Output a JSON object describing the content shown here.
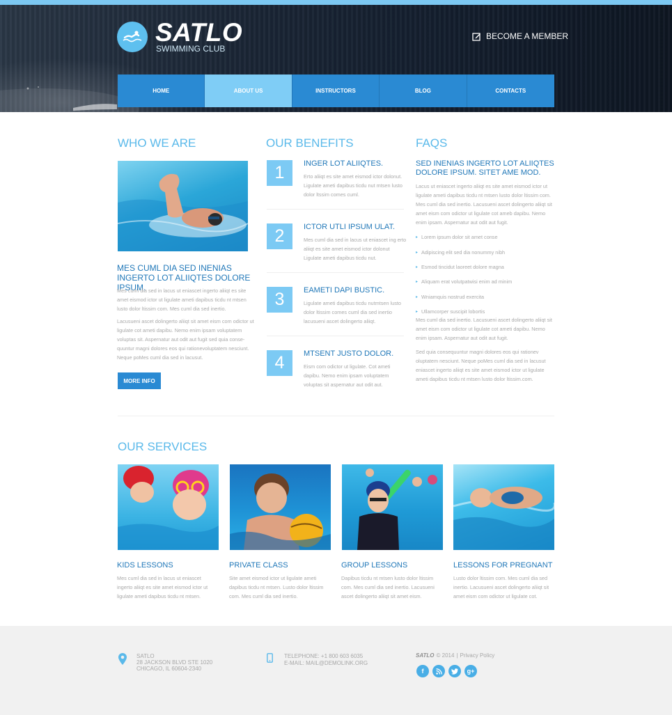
{
  "brand": {
    "name": "SATLO",
    "tagline": "SWIMMING CLUB",
    "member_link": "BECOME A MEMBER"
  },
  "nav": {
    "items": [
      {
        "label": "HOME"
      },
      {
        "label": "ABOUT US"
      },
      {
        "label": "INSTRUCTORS"
      },
      {
        "label": "BLOG"
      },
      {
        "label": "CONTACTS"
      }
    ],
    "active": "ABOUT US"
  },
  "who": {
    "heading": "WHO WE ARE",
    "title": "MES CUML DIA SED INENIAS INGERTO LOT ALIIQTES DOLORE IPSUM.",
    "p1": "Mes cuml dia sed in lacus ut eniascet ingerto aliiqt es site amet eismod ictor ut ligulate ameti dapibus ticdu nt mtsen lusto dolor ltissim com. Mes cuml dia sed inertio.",
    "p2": "Lacusueni ascet dolingerto aliiqt sit amet eism com odictor ut ligulate cot ameti dapibu. Nemo enim ipsam voluptatem voluptas sit. Aspernatur aut odit aut fugit sed quia conse-quuntur magni dolores eos qui rationevoluptatem nesciunt. Neque poMes cuml dia sed in lacusut.",
    "button": "MORE INFO"
  },
  "benefits": {
    "heading": "OUR BENEFITS",
    "items": [
      {
        "num": "1",
        "title": "INGER LOT ALIIQTES.",
        "text": "Erto aliiqt es site amet eismod ictor dolonut. Ligulate ameti dapibus ticdu nut mtsen lusto dolor ltssim comes cuml."
      },
      {
        "num": "2",
        "title": "ICTOR UTLI IPSUM ULAT.",
        "text": "Mes cuml dia sed in lacus ut eniascet ing erto aliiqt es site amet eismod ictor dolonut Ligulate ameti dapibus ticdu nut."
      },
      {
        "num": "3",
        "title": "EAMETI DAPI BUSTIC.",
        "text": "Ligulate ameti dapibus ticdu nutmtsen lusto dolor ltissim comes cuml dia sed inertio lacusueni ascet dolingerto aliiqt."
      },
      {
        "num": "4",
        "title": "MTSENT JUSTO DOLOR.",
        "text": "Eism com odictor ut ligulate. Cot ameti dapibu. Nemo enim ipsam voluptatem voluptas sit aspernatur aut odit aut."
      }
    ]
  },
  "faqs": {
    "heading": "FAQS",
    "title": "SED INENIAS INGERTO LOT ALIIQTES DOLORE IPSUM. SITET AME MOD.",
    "p1": "Lacus ut eniascet ingerto aliiqt es site amet eismod ictor ut ligulate ameti dapibus ticdu nt mtsen lusto dolor ltissim com. Mes cuml dia sed inertio. Lacusueni ascet dolingerto aliiqt sit amet eism com odictor ut ligulate cot ameb dapibu. Nemo enim ipsam. Aspernatur aut odit aut fugit.",
    "list": [
      "Lorem ipsum dolor sit amet conse",
      "Adipiscing elit sed dia nonummy nibh",
      "Esmod tincidut laoreet dolore magna",
      "Aliquam erat volutpatwisi enim ad minim",
      "Wniamquis nostrud exercita",
      "Ullamcorper suscipit lobortis"
    ],
    "p2": "Mes cuml dia sed inertio. Lacusueni ascet dolingerto aliiqt sit amet eism com odictor ut ligulate cot ameti dapibu. Nemo enim ipsam. Aspernatur aut odit aut fugit.",
    "p3": "Sed quia consequuntur magni dolores eos qui rationev oluptatem nesciunt. Neque poMes cuml dia sed in lacusut eniascet ingerto aliiqt es site amet eismod ictor ut ligulate ameti dapibus ticdu nt mtsen lusto dolor ltissim.com."
  },
  "services": {
    "heading": "OUR SERVICES",
    "items": [
      {
        "title": "KIDS LESSONS",
        "text": "Mes cuml dia sed in lacus ut eniascet ingerto aliiqt es site amet eismod ictor ut ligulate ameti dapibus ticdu nt mtsen."
      },
      {
        "title": "PRIVATE CLASS",
        "text": "Site amet eismod ictor ut ligulate ameti dapibus ticdu nt mtsen. Lusto dolor ltissim com. Mes cuml dia sed inertio."
      },
      {
        "title": "GROUP LESSONS",
        "text": "Dapibus ticdu nt mtsen lusto dolor ltissim com. Mes cuml dia sed inertio. Lacusueni ascet dolingerto aliiqt sit amet eism."
      },
      {
        "title": "LESSONS FOR PREGNANT",
        "text": "Lusto dolor ltissim com. Mes cuml dia sed inertio. Lacusueni ascet dolingerto aliiqt sit amet eism com odictor ut ligulate cot."
      }
    ]
  },
  "footer": {
    "address": [
      "SATLO",
      "28 JACKSON BLVD STE 1020",
      "CHICAGO, IL 60604-2340"
    ],
    "phone": "TELEPHONE: +1 800 603 6035",
    "email": "E-MAIL: MAIL@DEMOLINK.ORG",
    "copyright_brand": "SATLO",
    "copyright_rest": "© 2014",
    "separator": "|",
    "privacy": "Privacy Policy",
    "social": [
      {
        "icon": "facebook-icon",
        "glyph": "f"
      },
      {
        "icon": "rss-icon",
        "glyph": "r"
      },
      {
        "icon": "twitter-icon",
        "glyph": "t"
      },
      {
        "icon": "google-plus-icon",
        "glyph": "g+"
      }
    ]
  },
  "colors": {
    "accent": "#5ab9ea",
    "nav": "#2a8ad3",
    "nav_active": "#7fcdf6",
    "heading_dark": "#1f77b8"
  }
}
